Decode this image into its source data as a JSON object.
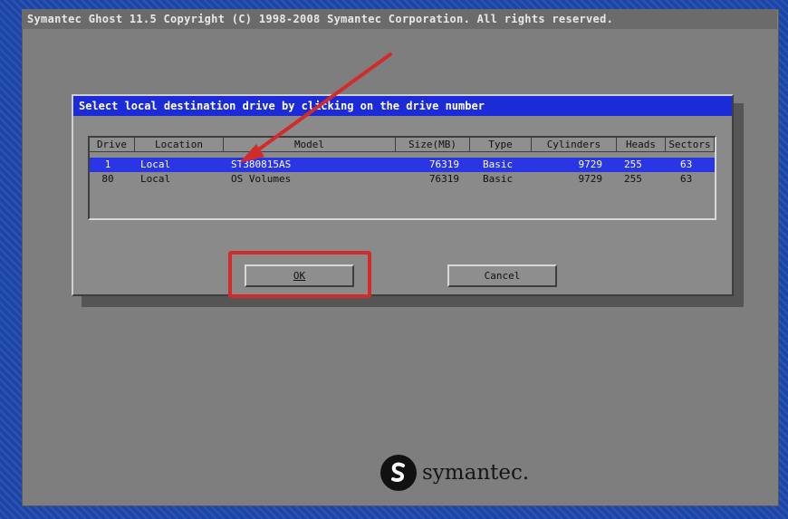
{
  "window": {
    "title": "Symantec Ghost 11.5   Copyright (C) 1998-2008 Symantec Corporation. All rights reserved."
  },
  "dialog": {
    "title": "Select local destination drive by clicking on the drive number",
    "columns": [
      "Drive",
      "Location",
      "Model",
      "Size(MB)",
      "Type",
      "Cylinders",
      "Heads",
      "Sectors"
    ],
    "rows": [
      {
        "drive": "1",
        "location": "Local",
        "model": "ST380815AS",
        "size": "76319",
        "type": "Basic",
        "cylinders": "9729",
        "heads": "255",
        "sectors": "63",
        "selected": true
      },
      {
        "drive": "80",
        "location": "Local",
        "model": "OS Volumes",
        "size": "76319",
        "type": "Basic",
        "cylinders": "9729",
        "heads": "255",
        "sectors": "63",
        "selected": false
      }
    ],
    "ok_label": "OK",
    "cancel_label": "Cancel"
  },
  "annotation": {
    "color": "#d22b2b",
    "icons": [
      "arrow-annotation-icon",
      "highlight-box"
    ]
  },
  "brand": {
    "name": "symantec.",
    "icon": "symantec-logo-icon"
  },
  "colors": {
    "selection": "#2a36e4",
    "dialog_title_bg": "#1c2bd8",
    "window_bg": "#7e7e7e"
  }
}
